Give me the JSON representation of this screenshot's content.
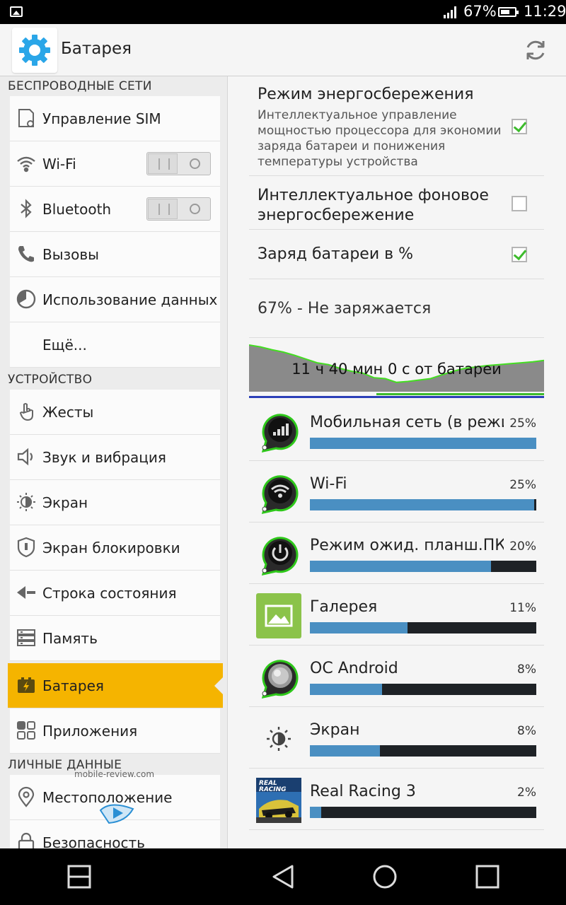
{
  "status_bar": {
    "battery_percent": "67%",
    "time": "11:29"
  },
  "action_bar": {
    "title": "Батарея",
    "refresh_icon": "refresh-icon",
    "settings_icon": "gear-icon"
  },
  "left_menu": {
    "section_wireless": "БЕСПРОВОДНЫЕ СЕТИ",
    "section_device": "УСТРОЙСТВО",
    "section_personal": "ЛИЧНЫЕ ДАННЫЕ",
    "items": [
      {
        "label": "Управление SIM",
        "icon": "sim-settings-icon"
      },
      {
        "label": "Wi-Fi",
        "icon": "wifi-icon",
        "toggle": "off"
      },
      {
        "label": "Bluetooth",
        "icon": "bluetooth-icon",
        "toggle": "off"
      },
      {
        "label": "Вызовы",
        "icon": "phone-icon"
      },
      {
        "label": "Использование данных",
        "icon": "data-usage-icon"
      },
      {
        "label": "Ещё..."
      },
      {
        "label": "Жесты",
        "icon": "gesture-icon"
      },
      {
        "label": "Звук и вибрация",
        "icon": "speaker-icon"
      },
      {
        "label": "Экран",
        "icon": "brightness-icon"
      },
      {
        "label": "Экран блокировки",
        "icon": "lock-screen-icon"
      },
      {
        "label": "Строка состояния",
        "icon": "status-bar-icon"
      },
      {
        "label": "Память",
        "icon": "storage-icon"
      },
      {
        "label": "Батарея",
        "icon": "battery-icon",
        "active": true
      },
      {
        "label": "Приложения",
        "icon": "apps-icon"
      },
      {
        "label": "Местоположение",
        "icon": "location-icon"
      },
      {
        "label": "Безопасность",
        "icon": "security-icon"
      }
    ]
  },
  "battery": {
    "power_saving": {
      "title": "Режим энергосбережения",
      "summary": "Интеллектуальное управление мощностью процессора для экономии заряда батареи и понижения температуры устройства",
      "checked": true
    },
    "background_saving": {
      "title": "Интеллектуальное фоновое энергосбережение",
      "checked": false
    },
    "show_percent": {
      "title": "Заряд батареи в %",
      "checked": true
    },
    "status": "67% - Не заряжается",
    "graph_label": "11 ч 40 мин 0 с от батареи",
    "graph_levels": [
      100,
      96,
      90,
      85,
      78,
      70,
      62,
      58,
      50,
      44,
      40,
      30,
      28,
      20,
      22,
      25,
      28,
      36,
      44,
      50,
      53,
      56,
      58,
      60,
      62,
      64,
      67
    ],
    "usage": [
      {
        "label": "Мобильная сеть (в режи",
        "percent": "25%",
        "fraction": 1.0,
        "icon": "signal-icon"
      },
      {
        "label": "Wi-Fi",
        "percent": "25%",
        "fraction": 0.99,
        "icon": "wifi-icon"
      },
      {
        "label": "Режим ожид. планш.ПК",
        "percent": "20%",
        "fraction": 0.8,
        "icon": "power-icon"
      },
      {
        "label": "Галерея",
        "percent": "11%",
        "fraction": 0.43,
        "icon": "gallery-icon"
      },
      {
        "label": "ОС Android",
        "percent": "8%",
        "fraction": 0.32,
        "icon": "android-os-icon"
      },
      {
        "label": "Экран",
        "percent": "8%",
        "fraction": 0.31,
        "icon": "brightness-icon"
      },
      {
        "label": "Real Racing 3",
        "percent": "2%",
        "fraction": 0.05,
        "icon": "real-racing-icon"
      }
    ]
  },
  "colors": {
    "accent": "#f5b400",
    "bar_fill": "#4a8fc2",
    "bar_bg": "#1e2226",
    "check": "#3dbb2c",
    "graph_line": "#44dd22"
  },
  "watermark": "mobile-review.com"
}
